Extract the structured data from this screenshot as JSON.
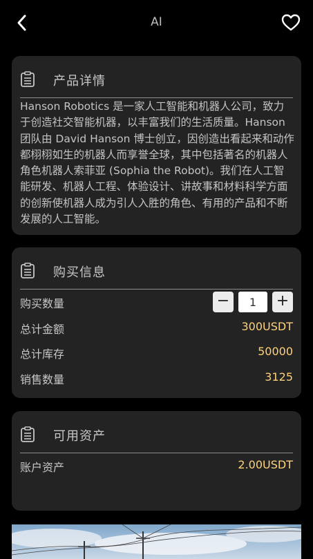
{
  "header": {
    "title": "AI",
    "back_icon": "chevron-left-icon",
    "favorite_icon": "heart-outline-icon"
  },
  "product_details": {
    "icon": "clipboard-icon",
    "title": "产品详情",
    "description": "Hanson Robotics 是一家人工智能和机器人公司，致力于创造社交智能机器，以丰富我们的生活质量。Hanson 团队由 David Hanson 博士创立，因创造出看起来和动作都栩栩如生的机器人而享誉全球，其中包括著名的机器人角色机器人索菲亚 (Sophia the Robot)。我们在人工智能研发、机器人工程、体验设计、讲故事和材料科学方面的创新使机器人成为引人入胜的角色、有用的产品和不断发展的人工智能。"
  },
  "purchase_info": {
    "icon": "clipboard-icon",
    "title": "购买信息",
    "quantity_label": "购买数量",
    "quantity_value": "1",
    "minus_label": "−",
    "plus_label": "+",
    "total_amount_label": "总计金额",
    "total_amount_value": "300USDT",
    "total_stock_label": "总计库存",
    "total_stock_value": "50000",
    "sales_label": "销售数量",
    "sales_value": "3125"
  },
  "available_assets": {
    "icon": "clipboard-icon",
    "title": "可用资产",
    "account_label": "账户资产",
    "account_value": "2.00USDT"
  },
  "colors": {
    "background": "#000000",
    "card": "#232323",
    "accent_value": "#ffd27a"
  }
}
